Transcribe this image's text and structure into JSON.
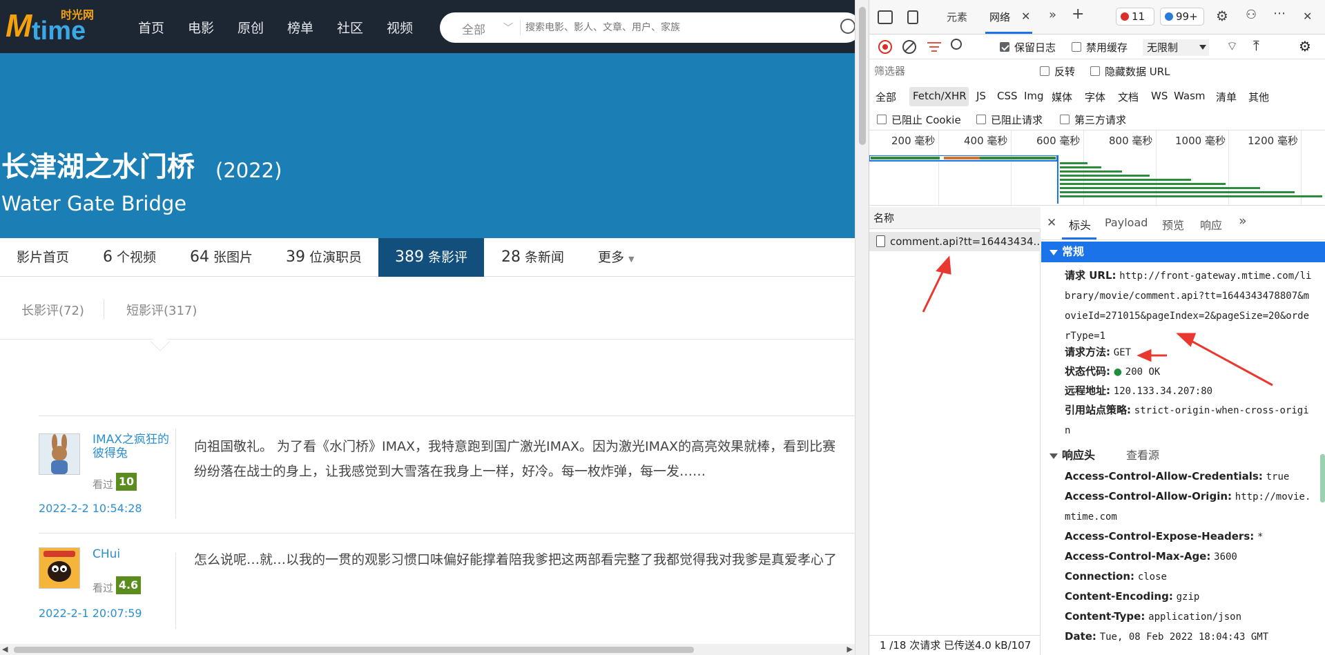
{
  "site": {
    "logo_text": "Mtime",
    "logo_cn": "时光网",
    "nav": [
      "首页",
      "电影",
      "原创",
      "榜单",
      "社区",
      "视频"
    ],
    "search_scope": "全部",
    "search_placeholder": "搜索电影、影人、文章、用户、家族"
  },
  "movie": {
    "title_cn": "长津湖之水门桥",
    "year": "(2022)",
    "title_en": "Water Gate Bridge"
  },
  "subnav": [
    {
      "num": "",
      "label": "影片首页"
    },
    {
      "num": "6",
      "label": " 个视频"
    },
    {
      "num": "64",
      "label": " 张图片"
    },
    {
      "num": "39",
      "label": " 位演职员"
    },
    {
      "num": "389",
      "label": " 条影评",
      "active": true
    },
    {
      "num": "28",
      "label": " 条新闻"
    },
    {
      "num": "",
      "label": "更多"
    }
  ],
  "review_tabs": [
    "长影评(72)",
    "短影评(317)"
  ],
  "reviews": [
    {
      "user": "IMAX之疯狂的彼得兔",
      "seen_label": "看过",
      "score": "10",
      "date": "2022-2-2 10:54:28",
      "text_line1": "向祖国敬礼。 为了看《水门桥》IMAX，我特意跑到国广激光IMAX。因为激光IMAX的高亮效果就棒，看到比赛",
      "text_line2": "纷纷落在战士的身上，让我感觉到大雪落在我身上一样，好冷。每一枚炸弹，每一发……"
    },
    {
      "user": "CHui",
      "seen_label": "看过",
      "score": "4.6",
      "date": "2022-2-1 20:07:59",
      "text_line1": "怎么说呢…就…以我的一贯的观影习惯口味偏好能撑着陪我爹把这两部看完整了我都觉得我对我爹是真爱孝心了",
      "text_line2": ""
    }
  ],
  "devtools": {
    "tabs": [
      "元素",
      "网络"
    ],
    "error_count": "11",
    "message_count": "99+",
    "preserve_log": "保留日志",
    "disable_cache": "禁用缓存",
    "throttle": "无限制",
    "filter_placeholder": "筛选器",
    "invert": "反转",
    "hide_data_url": "隐藏数据 URL",
    "types": [
      "全部",
      "Fetch/XHR",
      "JS",
      "CSS",
      "Img",
      "媒体",
      "字体",
      "文档",
      "WS",
      "Wasm",
      "清单",
      "其他"
    ],
    "blocked_cookie": "已阻止 Cookie",
    "blocked_requests": "已阻止请求",
    "third_party": "第三方请求",
    "timeline_ticks": [
      "200 毫秒",
      "400 毫秒",
      "600 毫秒",
      "800 毫秒",
      "1000 毫秒",
      "1200 毫秒"
    ],
    "name_header": "名称",
    "request_name": "comment.api?tt=16443434...",
    "footer": "1 /18 次请求  已传送4.0 kB/107",
    "detail_tabs": [
      "标头",
      "Payload",
      "预览",
      "响应"
    ],
    "general_title": "常规",
    "general": {
      "url_key": "请求 URL:",
      "url_val": "http://front-gateway.mtime.com/library/movie/comment.api?tt=1644343478807&movieId=271015&pageIndex=2&pageSize=20&orderType=1",
      "method_key": "请求方法:",
      "method_val": "GET",
      "status_key": "状态代码:",
      "status_val": "200 OK",
      "remote_key": "远程地址:",
      "remote_val": "120.133.34.207:80",
      "referrer_key": "引用站点策略:",
      "referrer_val": "strict-origin-when-cross-origin"
    },
    "response_headers_title": "响应头",
    "view_source": "查看源",
    "headers": [
      {
        "k": "Access-Control-Allow-Credentials:",
        "v": "true"
      },
      {
        "k": "Access-Control-Allow-Origin:",
        "v": "http://movie.mtime.com"
      },
      {
        "k": "Access-Control-Expose-Headers:",
        "v": "*"
      },
      {
        "k": "Access-Control-Max-Age:",
        "v": "3600"
      },
      {
        "k": "Connection:",
        "v": "close"
      },
      {
        "k": "Content-Encoding:",
        "v": "gzip"
      },
      {
        "k": "Content-Type:",
        "v": "application/json"
      },
      {
        "k": "Date:",
        "v": "Tue, 08 Feb 2022 18:04:43 GMT"
      }
    ]
  },
  "colors": {
    "header_bg": "#1c2733",
    "hero_bg": "#1b7fb6",
    "active_tab": "#124f7c",
    "link_blue": "#2b8fd1",
    "score_green": "#5b8c1e",
    "devtools_accent": "#1a73e8",
    "annotation_red": "#e8382f"
  }
}
